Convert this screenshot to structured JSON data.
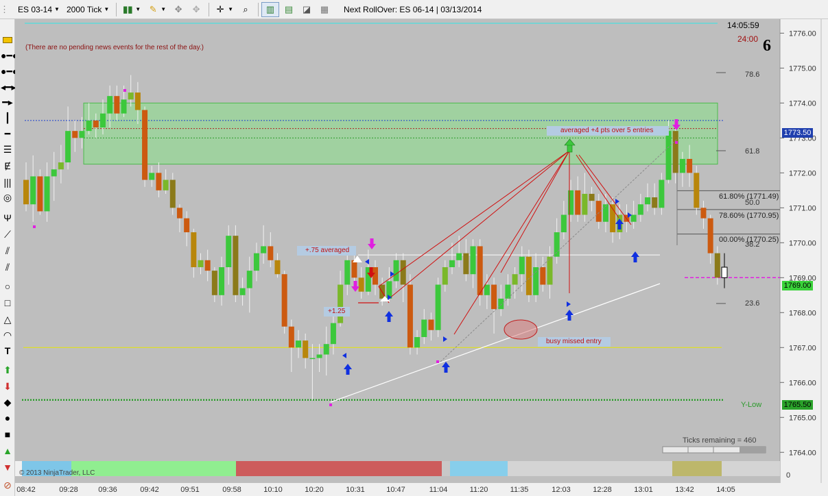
{
  "toolbar": {
    "instrument": "ES 03-14",
    "period": "2000 Tick",
    "rollover": "Next RollOver:  ES 06-14 | 03/13/2014"
  },
  "chart": {
    "clock": "14:05:59",
    "timer": "24:00",
    "corner_digit": "6",
    "news_message": "(There are no pending news events for the rest of the day.)",
    "copyright": "© 2013 NinjaTrader, LLC",
    "ticks_remaining": "Ticks remaining = 460",
    "annotations": {
      "averaged_entries": "averaged +4 pts over 5 entries",
      "plus_075": "+.75 averaged",
      "plus_125": "+1.25",
      "busy_missed": "busy missed entry",
      "ylow": "Y-Low"
    },
    "fib_labels": {
      "f786_top": "78.6",
      "f618": "61.8",
      "f500": "50.0",
      "f382": "38.2",
      "f236": "23.6",
      "ret618": "61.80% (1771.49)",
      "ret786": "78.60% (1770.95)",
      "ret100": "00.00% (1770.25)"
    },
    "price_axis": [
      "1776.00",
      "1775.00",
      "1774.00",
      "1773.00",
      "1772.00",
      "1771.00",
      "1770.00",
      "1769.00",
      "1768.00",
      "1767.00",
      "1766.00",
      "1765.00",
      "1764.00"
    ],
    "axis_bottom_zero": "0",
    "price_tags": {
      "blue": "1773.50",
      "green": "1769.00",
      "ylow": "1765.50"
    },
    "time_axis": [
      "08:42",
      "09:28",
      "09:36",
      "09:42",
      "09:51",
      "09:58",
      "10:10",
      "10:20",
      "10:31",
      "10:47",
      "11:04",
      "11:20",
      "11:35",
      "12:03",
      "12:28",
      "13:01",
      "13:42",
      "14:05"
    ]
  },
  "chart_data": {
    "type": "candlestick",
    "price_range": [
      1763.75,
      1776.4
    ],
    "candles": [
      [
        1771.8,
        1771.1,
        1772.3,
        1770.9
      ],
      [
        1771.1,
        1771.9,
        1772.5,
        1770.6
      ],
      [
        1771.9,
        1770.9,
        1772.1,
        1770.8
      ],
      [
        1770.9,
        1771.9,
        1772.3,
        1770.6
      ],
      [
        1771.9,
        1772.1,
        1772.6,
        1771.2
      ],
      [
        1772.1,
        1772.3,
        1772.8,
        1771.7
      ],
      [
        1772.3,
        1773.2,
        1773.9,
        1772.1
      ],
      [
        1773.2,
        1773.0,
        1773.5,
        1772.6
      ],
      [
        1773.0,
        1773.2,
        1773.6,
        1772.7
      ],
      [
        1773.2,
        1773.5,
        1774.0,
        1773.1
      ],
      [
        1773.5,
        1773.3,
        1773.7,
        1773.0
      ],
      [
        1773.3,
        1773.7,
        1774.1,
        1773.1
      ],
      [
        1773.7,
        1774.2,
        1774.5,
        1773.3
      ],
      [
        1774.2,
        1773.7,
        1774.5,
        1773.5
      ],
      [
        1773.7,
        1774.1,
        1774.5,
        1773.6
      ],
      [
        1774.1,
        1774.3,
        1774.8,
        1773.9
      ],
      [
        1774.3,
        1773.8,
        1774.6,
        1773.4
      ],
      [
        1773.8,
        1771.8,
        1773.9,
        1771.6
      ],
      [
        1771.8,
        1772.0,
        1772.2,
        1771.6
      ],
      [
        1772.0,
        1771.5,
        1772.3,
        1771.3
      ],
      [
        1771.5,
        1771.8,
        1772.1,
        1771.4
      ],
      [
        1771.8,
        1771.0,
        1772.0,
        1770.8
      ],
      [
        1771.0,
        1770.7,
        1771.1,
        1770.3
      ],
      [
        1770.7,
        1770.3,
        1770.9,
        1769.9
      ],
      [
        1770.3,
        1769.3,
        1770.4,
        1769.0
      ],
      [
        1769.3,
        1769.5,
        1769.7,
        1769.1
      ],
      [
        1769.5,
        1769.2,
        1769.8,
        1768.9
      ],
      [
        1769.2,
        1768.5,
        1769.3,
        1768.3
      ],
      [
        1768.5,
        1769.3,
        1769.6,
        1768.2
      ],
      [
        1769.3,
        1770.2,
        1770.5,
        1768.8
      ],
      [
        1770.2,
        1768.5,
        1770.5,
        1768.3
      ],
      [
        1768.5,
        1768.7,
        1769.0,
        1768.2
      ],
      [
        1768.7,
        1769.2,
        1769.6,
        1768.0
      ],
      [
        1769.2,
        1769.7,
        1770.0,
        1768.9
      ],
      [
        1769.7,
        1769.9,
        1770.5,
        1769.4
      ],
      [
        1769.9,
        1769.5,
        1770.3,
        1769.3
      ],
      [
        1769.5,
        1769.1,
        1769.7,
        1769.0
      ],
      [
        1769.1,
        1767.6,
        1769.2,
        1767.4
      ],
      [
        1767.6,
        1767.0,
        1767.8,
        1766.3
      ],
      [
        1767.0,
        1767.2,
        1767.5,
        1766.7
      ],
      [
        1767.2,
        1766.7,
        1767.4,
        1766.4
      ],
      [
        1766.7,
        1766.7,
        1767.1,
        1765.5
      ],
      [
        1766.7,
        1766.8,
        1767.1,
        1766.3
      ],
      [
        1766.8,
        1767.1,
        1767.6,
        1766.2
      ],
      [
        1767.1,
        1767.7,
        1768.0,
        1766.8
      ],
      [
        1767.7,
        1768.8,
        1769.2,
        1767.6
      ],
      [
        1768.8,
        1769.5,
        1769.8,
        1768.5
      ],
      [
        1769.5,
        1769.0,
        1769.7,
        1768.8
      ],
      [
        1769.0,
        1768.6,
        1769.3,
        1768.4
      ],
      [
        1768.6,
        1769.3,
        1769.8,
        1768.5
      ],
      [
        1769.3,
        1768.8,
        1769.5,
        1768.5
      ],
      [
        1768.8,
        1768.4,
        1769.0,
        1768.2
      ],
      [
        1768.4,
        1768.9,
        1769.3,
        1768.3
      ],
      [
        1768.9,
        1769.5,
        1769.7,
        1768.7
      ],
      [
        1769.5,
        1768.8,
        1769.7,
        1768.3
      ],
      [
        1768.8,
        1767.0,
        1769.1,
        1766.8
      ],
      [
        1767.0,
        1767.3,
        1767.5,
        1766.8
      ],
      [
        1767.3,
        1767.8,
        1768.1,
        1767.1
      ],
      [
        1767.8,
        1767.5,
        1768.0,
        1767.2
      ],
      [
        1767.5,
        1768.8,
        1769.0,
        1767.3
      ],
      [
        1768.8,
        1769.3,
        1769.5,
        1768.6
      ],
      [
        1769.3,
        1769.5,
        1770.0,
        1769.1
      ],
      [
        1769.5,
        1769.7,
        1770.2,
        1769.3
      ],
      [
        1769.7,
        1769.1,
        1770.1,
        1768.9
      ],
      [
        1769.1,
        1769.9,
        1770.1,
        1768.7
      ],
      [
        1769.9,
        1768.5,
        1770.1,
        1768.2
      ],
      [
        1768.5,
        1768.8,
        1769.1,
        1768.1
      ],
      [
        1768.8,
        1768.1,
        1769.0,
        1767.4
      ],
      [
        1768.1,
        1768.4,
        1768.8,
        1767.9
      ],
      [
        1768.4,
        1768.8,
        1769.1,
        1768.2
      ],
      [
        1768.8,
        1769.1,
        1769.3,
        1768.4
      ],
      [
        1769.1,
        1769.6,
        1769.9,
        1768.6
      ],
      [
        1769.6,
        1768.5,
        1769.8,
        1768.3
      ],
      [
        1768.5,
        1769.3,
        1769.7,
        1768.3
      ],
      [
        1769.3,
        1768.8,
        1769.6,
        1768.6
      ],
      [
        1768.8,
        1769.6,
        1769.9,
        1768.4
      ],
      [
        1769.6,
        1770.3,
        1770.7,
        1769.4
      ],
      [
        1770.3,
        1770.8,
        1771.2,
        1770.1
      ],
      [
        1770.8,
        1771.5,
        1771.8,
        1770.6
      ],
      [
        1771.5,
        1770.8,
        1771.9,
        1770.6
      ],
      [
        1770.8,
        1771.4,
        1772.0,
        1770.6
      ],
      [
        1771.4,
        1771.2,
        1771.6,
        1770.9
      ],
      [
        1771.2,
        1770.6,
        1771.4,
        1770.4
      ],
      [
        1770.6,
        1771.1,
        1771.4,
        1770.3
      ],
      [
        1771.1,
        1770.3,
        1771.3,
        1770.0
      ],
      [
        1770.3,
        1770.8,
        1771.1,
        1770.1
      ],
      [
        1770.8,
        1770.6,
        1771.1,
        1770.3
      ],
      [
        1770.6,
        1770.8,
        1771.2,
        1770.4
      ],
      [
        1770.8,
        1771.1,
        1771.4,
        1770.6
      ],
      [
        1771.1,
        1771.3,
        1771.7,
        1770.9
      ],
      [
        1771.3,
        1771.0,
        1771.7,
        1770.8
      ],
      [
        1771.0,
        1771.8,
        1772.0,
        1770.8
      ],
      [
        1771.8,
        1773.2,
        1773.5,
        1771.7
      ],
      [
        1773.2,
        1772.0,
        1773.3,
        1771.7
      ],
      [
        1772.0,
        1772.4,
        1772.6,
        1771.6
      ],
      [
        1772.4,
        1772.0,
        1772.8,
        1771.6
      ],
      [
        1772.0,
        1771.0,
        1772.2,
        1770.8
      ],
      [
        1771.0,
        1770.7,
        1771.2,
        1770.4
      ],
      [
        1770.7,
        1769.7,
        1770.8,
        1769.4
      ],
      [
        1769.7,
        1769.0,
        1769.9,
        1768.8
      ],
      [
        1769.0,
        1769.3,
        1769.7,
        1768.7
      ]
    ],
    "levels": {
      "blue_dotted": 1773.5,
      "red_dotted": 1773.27,
      "green_dotted": 1773.0,
      "zone_top": 1774.0,
      "zone_bottom": 1772.25,
      "white_line": 1769.65,
      "yellow_line": 1767.0,
      "ylow": 1765.5,
      "magenta_dash": 1769.0,
      "fib_upper": 1771.49,
      "fib_mid": 1770.95,
      "fib_low": 1770.25
    }
  }
}
